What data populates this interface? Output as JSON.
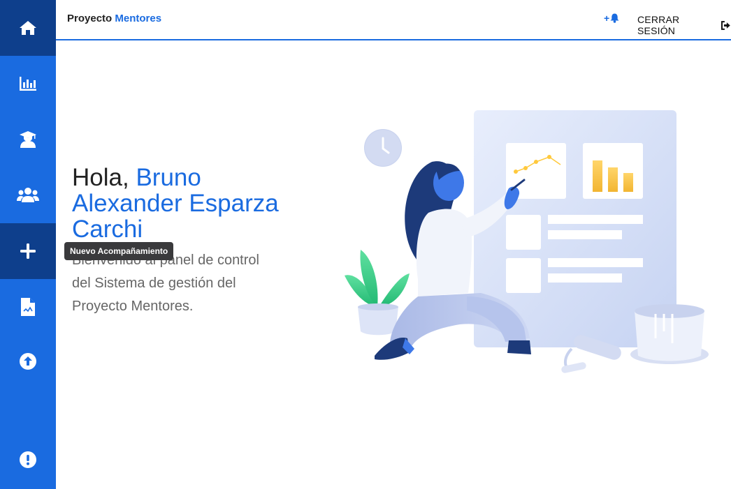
{
  "header": {
    "brand_prefix": "Proyecto",
    "brand_accent": "Mentores",
    "notif_plus": "+",
    "logout_label": "CERRAR SESIÓN"
  },
  "sidebar": {
    "items": [
      {
        "icon": "home-icon"
      },
      {
        "icon": "chart-icon"
      },
      {
        "icon": "graduate-icon"
      },
      {
        "icon": "users-icon"
      },
      {
        "icon": "plus-icon"
      },
      {
        "icon": "document-icon"
      },
      {
        "icon": "upload-icon"
      },
      {
        "icon": "alert-icon"
      }
    ],
    "tooltip": "Nuevo Acompañamiento"
  },
  "main": {
    "greeting_hello": "Hola,",
    "user_name": "Bruno Alexander Esparza Carchi",
    "welcome_text": "Bienvenido al panel de control del Sistema de gestión del Proyecto Mentores."
  },
  "colors": {
    "primary": "#1a6be0",
    "sidebar_active": "#0e3f8c",
    "tooltip_bg": "#3a3a3c"
  }
}
